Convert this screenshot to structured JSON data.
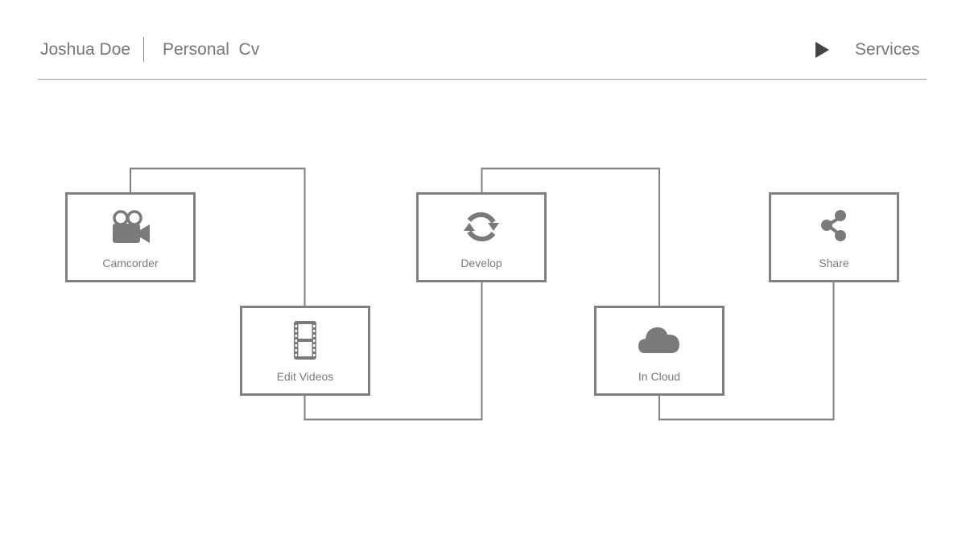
{
  "header": {
    "name": "Joshua Doe",
    "subtitle": "Personal  Cv",
    "nav_icon": "play-icon",
    "nav_label": "Services"
  },
  "colors": {
    "stroke": "#808080",
    "icon": "#7a7a7a",
    "text": "#777777",
    "play": "#444444"
  },
  "flow": {
    "nodes": [
      {
        "id": "camcorder",
        "label": "Camcorder",
        "icon": "video-camera-icon"
      },
      {
        "id": "edit-videos",
        "label": "Edit Videos",
        "icon": "film-icon"
      },
      {
        "id": "develop",
        "label": "Develop",
        "icon": "refresh-icon"
      },
      {
        "id": "in-cloud",
        "label": "In Cloud",
        "icon": "cloud-icon"
      },
      {
        "id": "share",
        "label": "Share",
        "icon": "share-icon"
      }
    ],
    "edges": [
      {
        "from": "camcorder",
        "to": "edit-videos"
      },
      {
        "from": "edit-videos",
        "to": "develop"
      },
      {
        "from": "develop",
        "to": "in-cloud"
      },
      {
        "from": "in-cloud",
        "to": "share"
      }
    ]
  }
}
